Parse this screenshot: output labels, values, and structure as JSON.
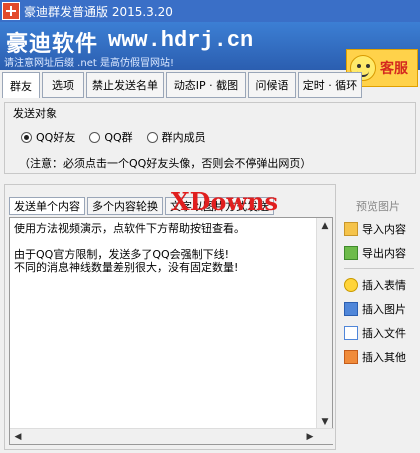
{
  "window": {
    "title": "豪迪群发普通版 2015.3.20"
  },
  "banner": {
    "brand": "豪迪软件",
    "url": "www.hdrj.cn",
    "note": "请注意网址后缀 .net 是高仿假冒网站!",
    "service_label": "客服"
  },
  "tabs": [
    "群友",
    "选项",
    "禁止发送名单",
    "动态IP · 截图",
    "问候语",
    "定时 · 循环"
  ],
  "send_target": {
    "group_title": "发送对象",
    "options": [
      {
        "label": "QQ好友",
        "checked": true
      },
      {
        "label": "QQ群",
        "checked": false
      },
      {
        "label": "群内成员",
        "checked": false
      }
    ],
    "note": "（注意：必须点击一个QQ好友头像，否则会不停弹出网页）"
  },
  "content": {
    "subtabs": [
      "发送单个内容",
      "多个内容轮换",
      "文字以图片方式发送"
    ],
    "watermark": "XDowns",
    "lines": [
      "使用方法视频演示，点软件下方帮助按钮查看。",
      "由于QQ官方限制，发送多了QQ会强制下线!",
      "不同的消息神线数量差别很大，没有固定数量!"
    ]
  },
  "side": {
    "preview": "预览图片",
    "buttons": [
      {
        "label": "导入内容",
        "icon": "folder-icon"
      },
      {
        "label": "导出内容",
        "icon": "export-icon"
      },
      {
        "label": "插入表情",
        "icon": "emoji-icon"
      },
      {
        "label": "插入图片",
        "icon": "picture-icon"
      },
      {
        "label": "插入文件",
        "icon": "file-icon"
      },
      {
        "label": "插入其他",
        "icon": "other-icon"
      }
    ]
  }
}
